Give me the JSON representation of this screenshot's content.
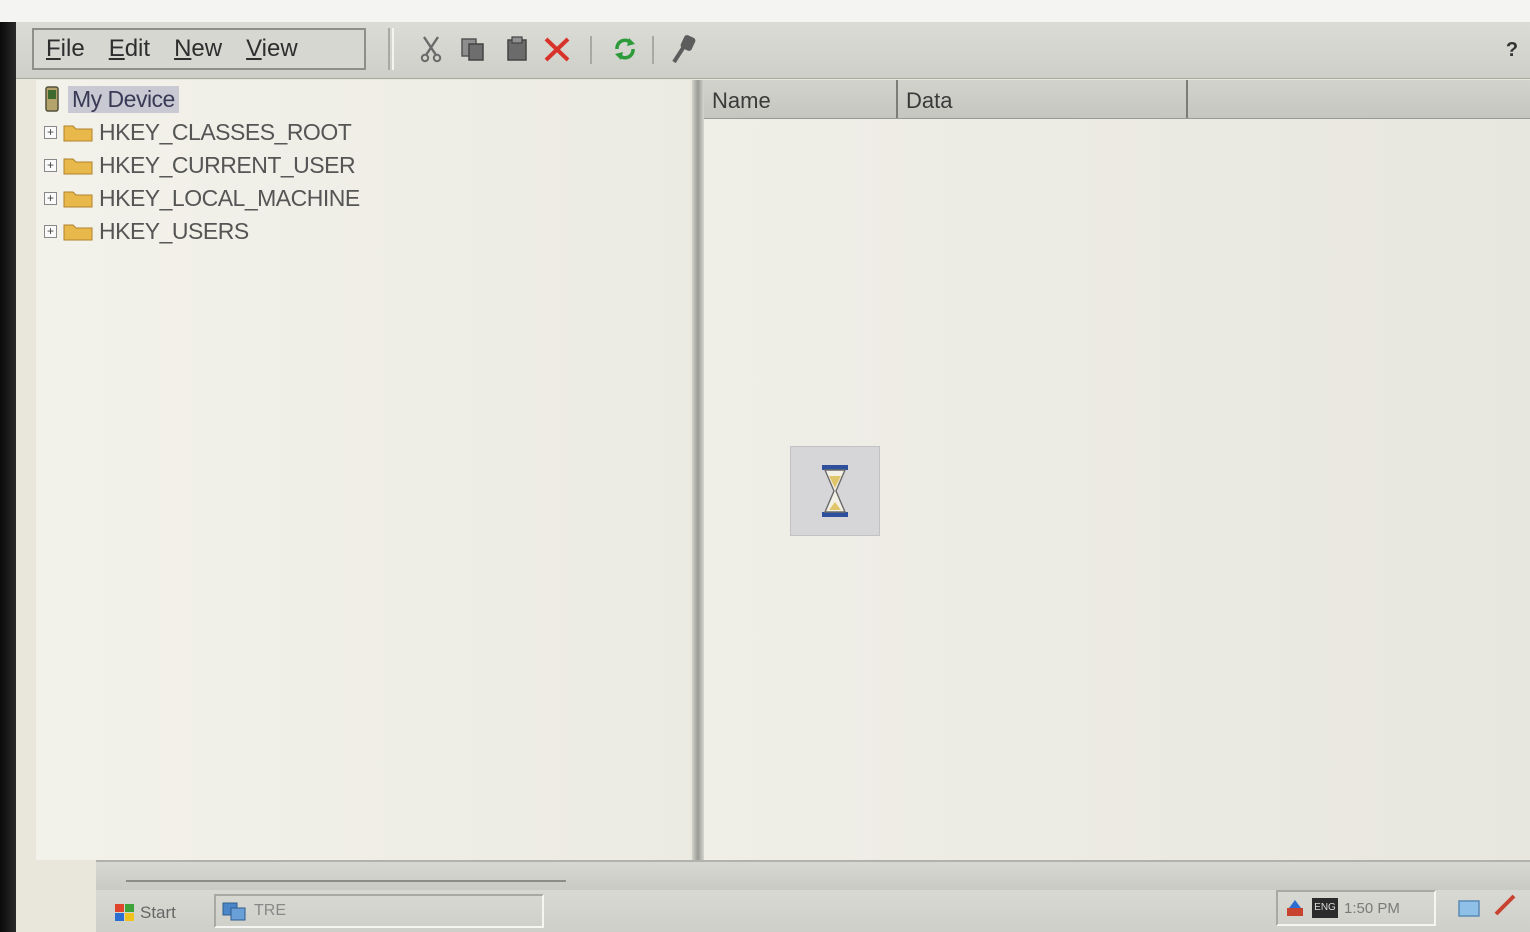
{
  "menu": {
    "items": [
      {
        "label": "File"
      },
      {
        "label": "Edit"
      },
      {
        "label": "New"
      },
      {
        "label": "View"
      }
    ],
    "help_label": "?"
  },
  "toolbar": {
    "buttons": [
      "cut-icon",
      "copy-icon",
      "paste-icon",
      "delete-icon",
      "refresh-icon",
      "find-icon"
    ]
  },
  "tree": {
    "root_label": "My Device",
    "keys": [
      {
        "label": "HKEY_CLASSES_ROOT"
      },
      {
        "label": "HKEY_CURRENT_USER"
      },
      {
        "label": "HKEY_LOCAL_MACHINE"
      },
      {
        "label": "HKEY_USERS"
      }
    ]
  },
  "list": {
    "columns": [
      "Name",
      "Data"
    ]
  },
  "taskbar": {
    "start_label": "Start",
    "task_label": "TRE",
    "clock": "1:50 PM",
    "input_badge": "ENG"
  },
  "colors": {
    "selection": "#c9c9d4",
    "folder": "#e8b84a",
    "refresh": "#2e9b3a",
    "delete": "#d8332a"
  }
}
